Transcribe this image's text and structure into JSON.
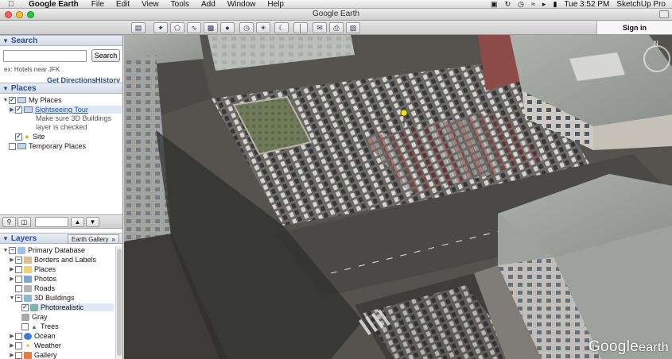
{
  "menubar": {
    "app_name": "Google Earth",
    "menus": [
      "File",
      "Edit",
      "View",
      "Tools",
      "Add",
      "Window",
      "Help"
    ],
    "clock": "Tue 3:52 PM",
    "extra_app": "SketchUp Pro"
  },
  "window": {
    "title": "Google Earth"
  },
  "toolbar": {
    "sign_in_label": "Sign in"
  },
  "search": {
    "section_title": "Search",
    "input_value": "",
    "button_label": "Search",
    "example_text": "ex: Hotels near JFK",
    "get_directions_label": "Get Directions",
    "history_label": "History"
  },
  "places": {
    "section_title": "Places",
    "my_places": "My Places",
    "sightseeing_tour": "Sightseeing Tour",
    "hint_line1": "Make sure 3D Buildings",
    "hint_line2": "layer is checked",
    "site": "Site",
    "temporary_places": "Temporary Places"
  },
  "layers": {
    "section_title": "Layers",
    "earth_gallery_label": "Earth Gallery",
    "items": [
      "Primary Database",
      "Borders and Labels",
      "Places",
      "Photos",
      "Roads",
      "3D Buildings",
      "Photorealistic",
      "Gray",
      "Trees",
      "Ocean",
      "Weather",
      "Gallery"
    ]
  },
  "map": {
    "watermark_brand": "Google",
    "watermark_suffix": "earth"
  },
  "colors": {
    "accent_blue": "#2a4f8c",
    "section_header": "#d3dbe7",
    "selection": "#dfe8f6"
  }
}
